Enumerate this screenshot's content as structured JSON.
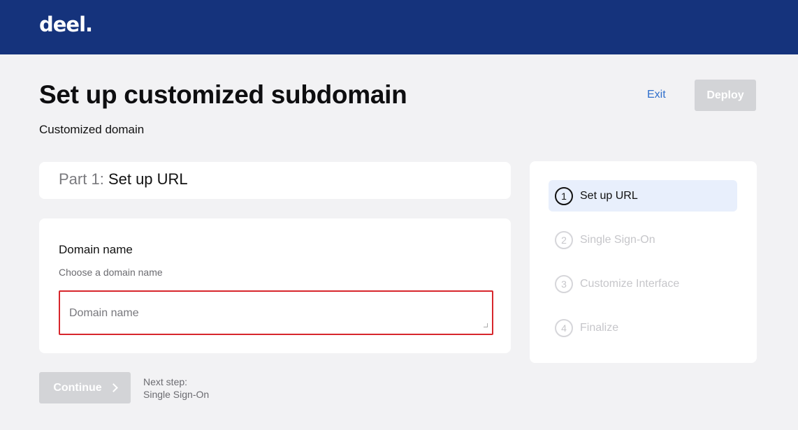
{
  "header": {
    "logo_text": "deel."
  },
  "page": {
    "title": "Set up customized subdomain",
    "subtitle": "Customized domain",
    "exit_label": "Exit",
    "deploy_label": "Deploy"
  },
  "part": {
    "prefix": "Part 1:",
    "name": "Set up URL"
  },
  "form": {
    "label": "Domain name",
    "help": "Choose a domain name",
    "placeholder": "Domain name",
    "value": ""
  },
  "footer": {
    "continue_label": "Continue",
    "next_step_label": "Next step:",
    "next_step_value": "Single Sign-On"
  },
  "steps": [
    {
      "num": "1",
      "label": "Set up URL",
      "active": true
    },
    {
      "num": "2",
      "label": "Single Sign-On",
      "active": false
    },
    {
      "num": "3",
      "label": "Customize Interface",
      "active": false
    },
    {
      "num": "4",
      "label": "Finalize",
      "active": false
    }
  ],
  "colors": {
    "header_bg": "#15337c",
    "error_border": "#d7262c",
    "link": "#2f6fcc",
    "active_step_bg": "#e8effc",
    "disabled_button": "#d3d4d7"
  }
}
